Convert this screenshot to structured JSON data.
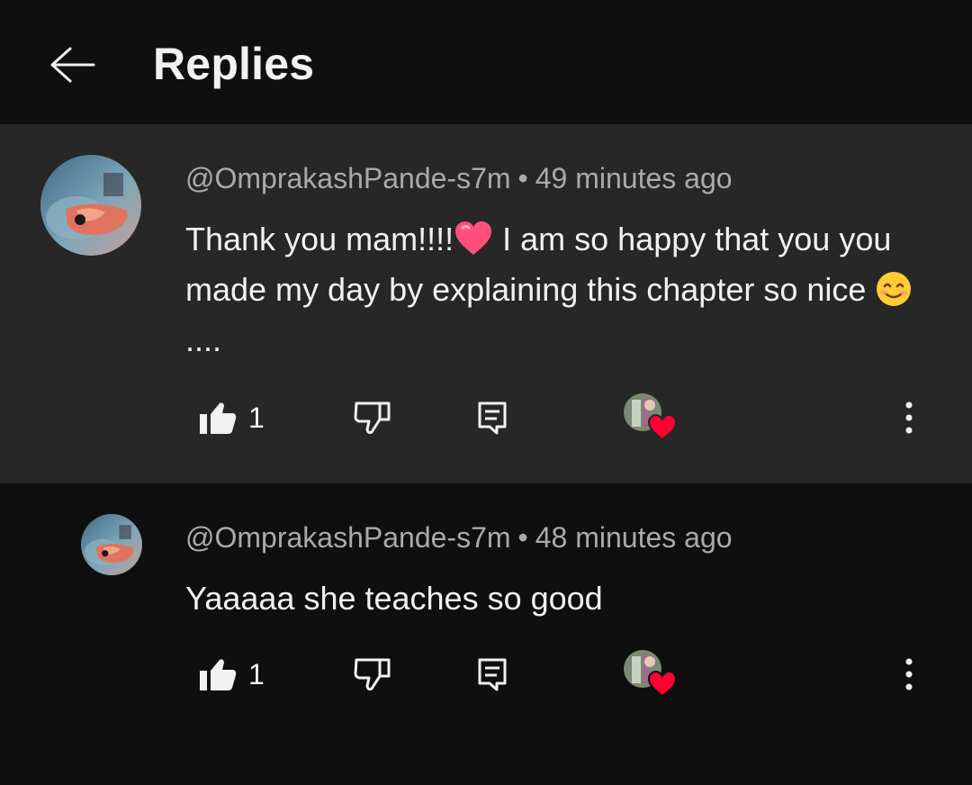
{
  "header": {
    "title": "Replies",
    "back_icon": "arrow-left-icon"
  },
  "comments": [
    {
      "handle": "@OmprakashPande-s7m",
      "separator": "•",
      "time": "49 minutes ago",
      "text_part1": "Thank you mam!!!!",
      "text_part2": " I am so happy that you you made my day by explaining this chapter so nice ",
      "text_part3": "....",
      "emojis": [
        "heart-emoji",
        "smiling-face-emoji"
      ],
      "like_count": "1",
      "highlighted": true
    },
    {
      "handle": "@OmprakashPande-s7m",
      "separator": "•",
      "time": "48 minutes ago",
      "text": "Yaaaaa she teaches so good",
      "like_count": "1",
      "highlighted": false
    }
  ],
  "colors": {
    "background": "#0f0f0f",
    "highlight_background": "#272727",
    "text_primary": "#f1f1f1",
    "text_secondary": "#aaaaaa",
    "heart_red": "#ff0033"
  },
  "icons": [
    "thumbs-up-icon",
    "thumbs-down-icon",
    "reply-icon",
    "creator-heart-icon",
    "more-vertical-icon"
  ]
}
